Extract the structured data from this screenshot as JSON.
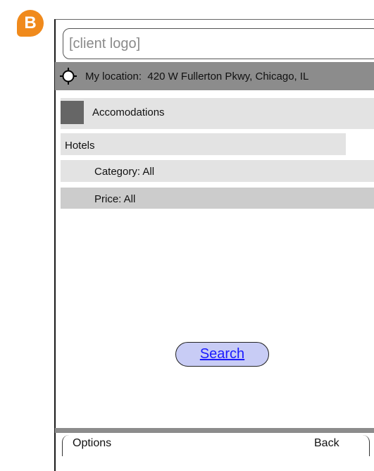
{
  "badge": {
    "letter": "B",
    "color": "#f08a1c"
  },
  "header": {
    "logo_placeholder": "[client logo]"
  },
  "location": {
    "icon": "crosshair-icon",
    "label": "My location:",
    "value": "420 W Fullerton Pkwy, Chicago, IL"
  },
  "menu": {
    "category_label": "Accomodations",
    "subcategory_label": "Hotels",
    "filters": [
      {
        "label": "Category: All"
      },
      {
        "label": "Price: All"
      }
    ]
  },
  "actions": {
    "search_label": "Search"
  },
  "softkeys": {
    "left": "Options",
    "right": "Back"
  },
  "colors": {
    "bar_gray": "#8c8c8c",
    "row_light": "#e3e3e3",
    "row_selected": "#cccccc",
    "button_fill": "#c8ccf5",
    "link_blue": "#1a1aff"
  }
}
